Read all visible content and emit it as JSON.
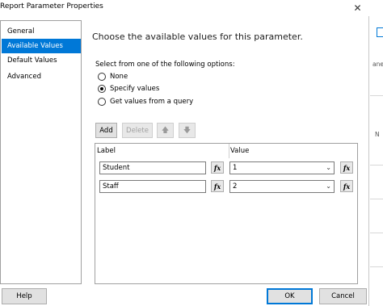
{
  "window": {
    "title": "Report Parameter Properties",
    "close_symbol": "✕"
  },
  "nav": {
    "items": [
      {
        "label": "General"
      },
      {
        "label": "Available Values"
      },
      {
        "label": "Default Values"
      },
      {
        "label": "Advanced"
      }
    ],
    "selected_index": 1
  },
  "main": {
    "heading": "Choose the available values for this parameter.",
    "options_label": "Select from one of the following options:",
    "radio_options": [
      {
        "label": "None",
        "checked": false
      },
      {
        "label": "Specify values",
        "checked": true
      },
      {
        "label": "Get values from a query",
        "checked": false
      }
    ]
  },
  "toolbar": {
    "add_label": "Add",
    "delete_label": "Delete",
    "move_up_icon": "arrow-up-icon",
    "move_down_icon": "arrow-down-icon"
  },
  "grid": {
    "columns": [
      "Label",
      "Value"
    ],
    "rows": [
      {
        "label": "Student",
        "value": "1"
      },
      {
        "label": "Staff",
        "value": "2"
      }
    ],
    "fx_symbol": "fx"
  },
  "footer": {
    "help_label": "Help",
    "ok_label": "OK",
    "cancel_label": "Cancel"
  },
  "background": {
    "fragment_1": "ane",
    "fragment_2": "N"
  },
  "colors": {
    "selection": "#0078d7",
    "button_face": "#e1e1e1",
    "border": "#a0a0a0"
  }
}
